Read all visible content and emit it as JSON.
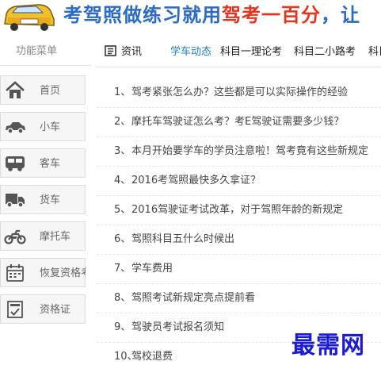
{
  "header": {
    "slogan_part1": "考驾照做练习就用",
    "slogan_highlight": "驾考一百分",
    "slogan_part2": "，让"
  },
  "menu": {
    "title": "功能菜单",
    "items": [
      {
        "label": "首页",
        "icon": "home-icon"
      },
      {
        "label": "小车",
        "icon": "car-icon"
      },
      {
        "label": "客车",
        "icon": "bus-icon"
      },
      {
        "label": "货车",
        "icon": "truck-icon"
      },
      {
        "label": "摩托车",
        "icon": "motorcycle-icon"
      },
      {
        "label": "恢复资格考",
        "icon": "calendar-icon"
      },
      {
        "label": "资格证",
        "icon": "certificate-icon"
      }
    ]
  },
  "tabs": {
    "news_label": "资讯",
    "items": [
      {
        "label": "学车动态",
        "active": true
      },
      {
        "label": "科目一理论考",
        "active": false
      },
      {
        "label": "科目二小路考",
        "active": false
      },
      {
        "label": "科目",
        "active": false
      }
    ]
  },
  "articles": [
    {
      "num": "1、",
      "title": "驾考紧张怎么办？这些都是可以实际操作的经验"
    },
    {
      "num": "2、",
      "title": "摩托车驾驶证怎么考？考E驾驶证需要多少钱？"
    },
    {
      "num": "3、",
      "title": "本月开始要学车的学员注意啦！驾考竟有这些新规定"
    },
    {
      "num": "4、",
      "title": "2016考驾照最快多久拿证？"
    },
    {
      "num": "5、",
      "title": "2016驾驶证考试改革，对于驾照年龄的新规定"
    },
    {
      "num": "6、",
      "title": "驾照科目五什么时候出"
    },
    {
      "num": "7、",
      "title": "学车费用"
    },
    {
      "num": "8、",
      "title": "驾照考试新规定亮点提前看"
    },
    {
      "num": "9、",
      "title": "驾驶员考试报名须知"
    },
    {
      "num": "10、",
      "title": "驾校退费"
    }
  ],
  "watermark": "最需网",
  "colors": {
    "accent": "#1e7fd0",
    "slogan": "#2a6ac9",
    "highlight": "#e8341c",
    "watermark": "#1a1ad8"
  }
}
